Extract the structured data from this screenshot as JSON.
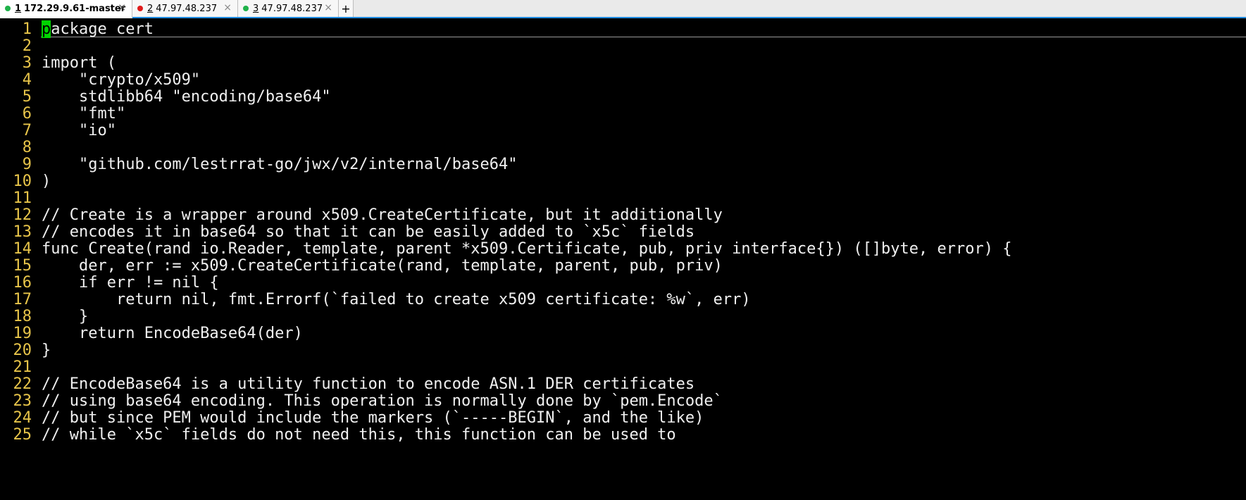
{
  "tabs": [
    {
      "number": "1",
      "host": "172.29.9.61-master",
      "status_color": "#1fb24a",
      "active": true,
      "close": "×"
    },
    {
      "number": "2",
      "host": "47.97.48.237",
      "status_color": "#e01b1b",
      "active": false,
      "close": "×"
    },
    {
      "number": "3",
      "host": "47.97.48.237",
      "status_color": "#1fb24a",
      "active": false,
      "close": "×"
    }
  ],
  "new_tab_label": "+",
  "editor": {
    "cursor_char": "p",
    "lines": [
      {
        "n": "1",
        "text": "ackage cert"
      },
      {
        "n": "2",
        "text": ""
      },
      {
        "n": "3",
        "text": "import ("
      },
      {
        "n": "4",
        "text": "    \"crypto/x509\""
      },
      {
        "n": "5",
        "text": "    stdlibb64 \"encoding/base64\""
      },
      {
        "n": "6",
        "text": "    \"fmt\""
      },
      {
        "n": "7",
        "text": "    \"io\""
      },
      {
        "n": "8",
        "text": ""
      },
      {
        "n": "9",
        "text": "    \"github.com/lestrrat-go/jwx/v2/internal/base64\""
      },
      {
        "n": "10",
        "text": ")"
      },
      {
        "n": "11",
        "text": ""
      },
      {
        "n": "12",
        "text": "// Create is a wrapper around x509.CreateCertificate, but it additionally"
      },
      {
        "n": "13",
        "text": "// encodes it in base64 so that it can be easily added to `x5c` fields"
      },
      {
        "n": "14",
        "text": "func Create(rand io.Reader, template, parent *x509.Certificate, pub, priv interface{}) ([]byte, error) {"
      },
      {
        "n": "15",
        "text": "    der, err := x509.CreateCertificate(rand, template, parent, pub, priv)"
      },
      {
        "n": "16",
        "text": "    if err != nil {"
      },
      {
        "n": "17",
        "text": "        return nil, fmt.Errorf(`failed to create x509 certificate: %w`, err)"
      },
      {
        "n": "18",
        "text": "    }"
      },
      {
        "n": "19",
        "text": "    return EncodeBase64(der)"
      },
      {
        "n": "20",
        "text": "}"
      },
      {
        "n": "21",
        "text": ""
      },
      {
        "n": "22",
        "text": "// EncodeBase64 is a utility function to encode ASN.1 DER certificates"
      },
      {
        "n": "23",
        "text": "// using base64 encoding. This operation is normally done by `pem.Encode`"
      },
      {
        "n": "24",
        "text": "// but since PEM would include the markers (`-----BEGIN`, and the like)"
      },
      {
        "n": "25",
        "text": "// while `x5c` fields do not need this, this function can be used to"
      }
    ]
  }
}
